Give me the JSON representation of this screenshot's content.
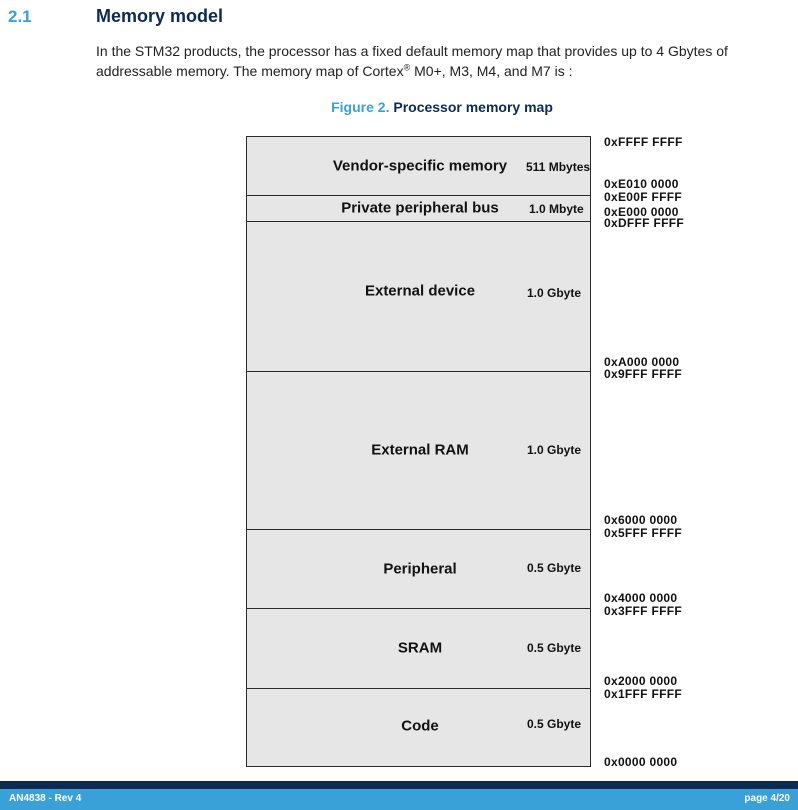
{
  "section": {
    "number": "2.1",
    "title": "Memory model"
  },
  "intro": {
    "part1": "In the STM32 products, the processor has a fixed default memory map that provides up to 4 Gbytes of addressable memory. The memory map of Cortex",
    "reg": "®",
    "part2": " M0+, M3, M4, and M7 is :"
  },
  "figure": {
    "label": "Figure 2.",
    "title": "Processor memory map"
  },
  "regions": [
    {
      "name": "Vendor-specific memory",
      "size": "511 Mbytes"
    },
    {
      "name": "Private peripheral bus",
      "size": "1.0 Mbyte"
    },
    {
      "name": "External device",
      "size": "1.0 Gbyte"
    },
    {
      "name": "External RAM",
      "size": "1.0 Gbyte"
    },
    {
      "name": "Peripheral",
      "size": "0.5 Gbyte"
    },
    {
      "name": "SRAM",
      "size": "0.5 Gbyte"
    },
    {
      "name": "Code",
      "size": "0.5 Gbyte"
    }
  ],
  "addresses": [
    "0xFFFF FFFF",
    "0xE010 0000",
    "0xE00F FFFF",
    "0xE000 0000",
    "0xDFFF FFFF",
    "0xA000 0000",
    "0x9FFF FFFF",
    "0x6000 0000",
    "0x5FFF FFFF",
    "0x4000 0000",
    "0x3FFF FFFF",
    "0x2000 0000",
    "0x1FFF FFFF",
    "0x0000 0000"
  ],
  "footer": {
    "doc_id": "AN4838 - Rev 4",
    "page": "page 4/20"
  },
  "colors": {
    "accent": "#3aa0d8",
    "navy": "#0d2a52",
    "region_fill": "#e6e6e6"
  }
}
